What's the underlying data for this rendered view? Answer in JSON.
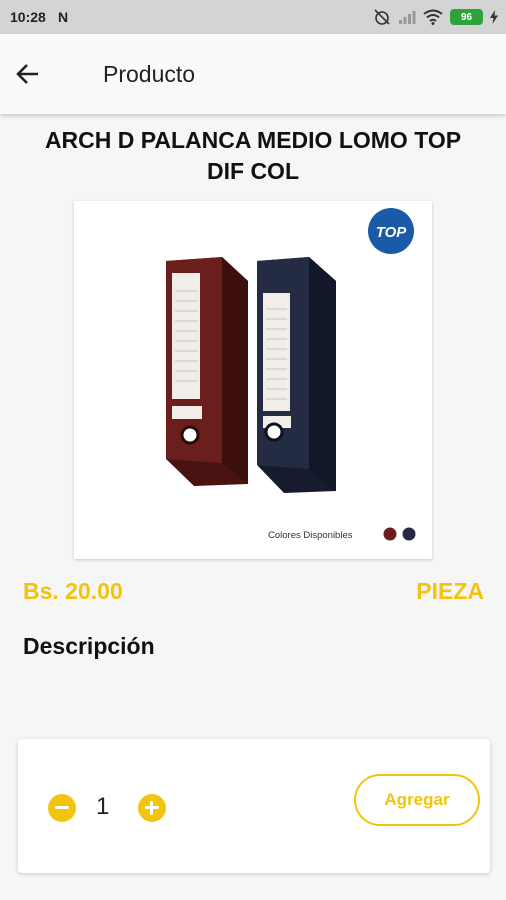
{
  "status_bar": {
    "time": "10:28",
    "battery": "96"
  },
  "app_bar": {
    "title": "Producto"
  },
  "product": {
    "name": "ARCH D PALANCA MEDIO LOMO TOP DIF COL",
    "price": "Bs. 20.00",
    "unit": "PIEZA",
    "image": {
      "brand_logo": "TOP",
      "caption": "Colores Disponibles",
      "colors": [
        "#6b1f1c",
        "#232c43"
      ]
    },
    "description_heading": "Descripción"
  },
  "cart": {
    "quantity": "1",
    "add_label": "Agregar"
  }
}
